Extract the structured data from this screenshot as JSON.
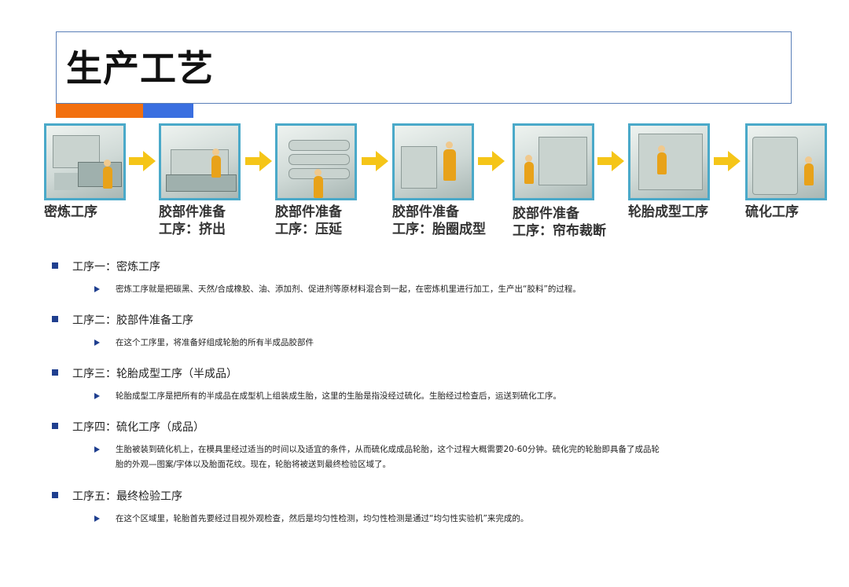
{
  "header": {
    "title": "生产工艺"
  },
  "steps": [
    {
      "label_line1": "密炼工序",
      "label_line2": ""
    },
    {
      "label_line1": "胶部件准备",
      "label_line2": "工序：挤出"
    },
    {
      "label_line1": "胶部件准备",
      "label_line2": "工序：压延"
    },
    {
      "label_line1": "胶部件准备",
      "label_line2": "工序：胎圈成型"
    },
    {
      "label_line1": "胶部件准备",
      "label_line2": "工序：帘布裁断"
    },
    {
      "label_line1": "轮胎成型工序",
      "label_line2": ""
    },
    {
      "label_line1": "硫化工序",
      "label_line2": ""
    }
  ],
  "process": [
    {
      "heading": "工序一：密炼工序",
      "detail": "密炼工序就是把碳黑、天然/合成橡胶、油、添加剂、促进剂等原材料混合到一起，在密炼机里进行加工，生产出“胶料”的过程。"
    },
    {
      "heading": "工序二：胶部件准备工序",
      "detail": "在这个工序里，将准备好组成轮胎的所有半成品胶部件"
    },
    {
      "heading": "工序三：轮胎成型工序（半成品）",
      "detail": "轮胎成型工序是把所有的半成品在成型机上组装成生胎，这里的生胎是指没经过硫化。生胎经过检查后，运送到硫化工序。"
    },
    {
      "heading": "工序四：硫化工序（成品）",
      "detail": "生胎被装到硫化机上，在模具里经过适当的时间以及适宜的条件，从而硫化成成品轮胎，这个过程大概需要20-60分钟。硫化完的轮胎即具备了成品轮",
      "detail2": "胎的外观—图案/字体以及胎面花纹。现在，轮胎将被送到最终检验区域了。"
    },
    {
      "heading": "工序五：最终检验工序",
      "detail": "在这个区域里，轮胎首先要经过目视外观检查，然后是均匀性检测，均匀性检测是通过“均匀性实验机”来完成的。"
    }
  ],
  "colors": {
    "accent_orange": "#f2700f",
    "accent_blue": "#3a6fe0",
    "arrow": "#f5c518",
    "bullet": "#1f3f8f",
    "photo_border": "#4aa9c9"
  }
}
